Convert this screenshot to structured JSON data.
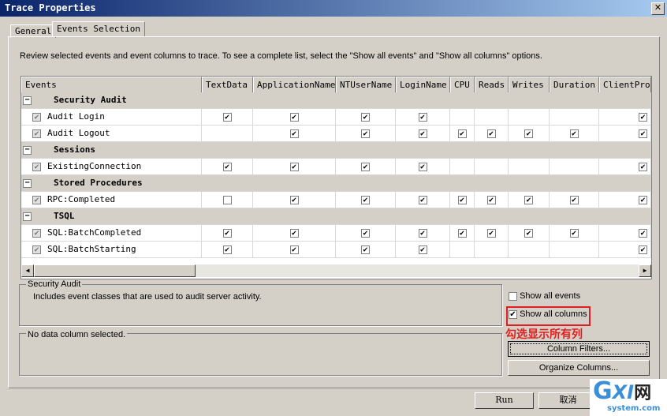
{
  "window": {
    "title": "Trace Properties",
    "close": "✕"
  },
  "tabs": [
    {
      "label": "General"
    },
    {
      "label": "Events Selection",
      "active": true
    }
  ],
  "instructions": "Review selected events and event columns to trace. To see a complete list, select the \"Show all events\" and \"Show all columns\" options.",
  "grid": {
    "columns": [
      "Events",
      "TextData",
      "ApplicationName",
      "NTUserName",
      "LoginName",
      "CPU",
      "Reads",
      "Writes",
      "Duration",
      "ClientProc"
    ],
    "rows": [
      {
        "category": "Security Audit"
      },
      {
        "event": "Audit Login",
        "checks": [
          true,
          true,
          true,
          true,
          null,
          null,
          null,
          null,
          true
        ]
      },
      {
        "event": "Audit Logout",
        "checks": [
          null,
          true,
          true,
          true,
          true,
          true,
          true,
          true,
          true
        ]
      },
      {
        "category": "Sessions"
      },
      {
        "event": "ExistingConnection",
        "checks": [
          true,
          true,
          true,
          true,
          null,
          null,
          null,
          null,
          true
        ]
      },
      {
        "category": "Stored Procedures"
      },
      {
        "event": "RPC:Completed",
        "checks": [
          false,
          true,
          true,
          true,
          true,
          true,
          true,
          true,
          true
        ]
      },
      {
        "category": "TSQL"
      },
      {
        "event": "SQL:BatchCompleted",
        "checks": [
          true,
          true,
          true,
          true,
          true,
          true,
          true,
          true,
          true
        ]
      },
      {
        "event": "SQL:BatchStarting",
        "checks": [
          true,
          true,
          true,
          true,
          null,
          null,
          null,
          null,
          true
        ]
      }
    ]
  },
  "description": {
    "title": "Security Audit",
    "text": "Includes event classes that are used to audit server activity."
  },
  "column_info": {
    "text": "No data column selected."
  },
  "options": {
    "show_all_events": {
      "label": "Show all events",
      "checked": false
    },
    "show_all_columns": {
      "label": "Show all columns",
      "checked": true
    }
  },
  "annotation": {
    "text": "勾选显示所有列",
    "color": "#e02020"
  },
  "buttons": {
    "column_filters": "Column Filters...",
    "organize_columns": "Organize Columns...",
    "run": "Run",
    "cancel": "取消"
  },
  "watermark": {
    "text": "GXI网 system.com"
  }
}
